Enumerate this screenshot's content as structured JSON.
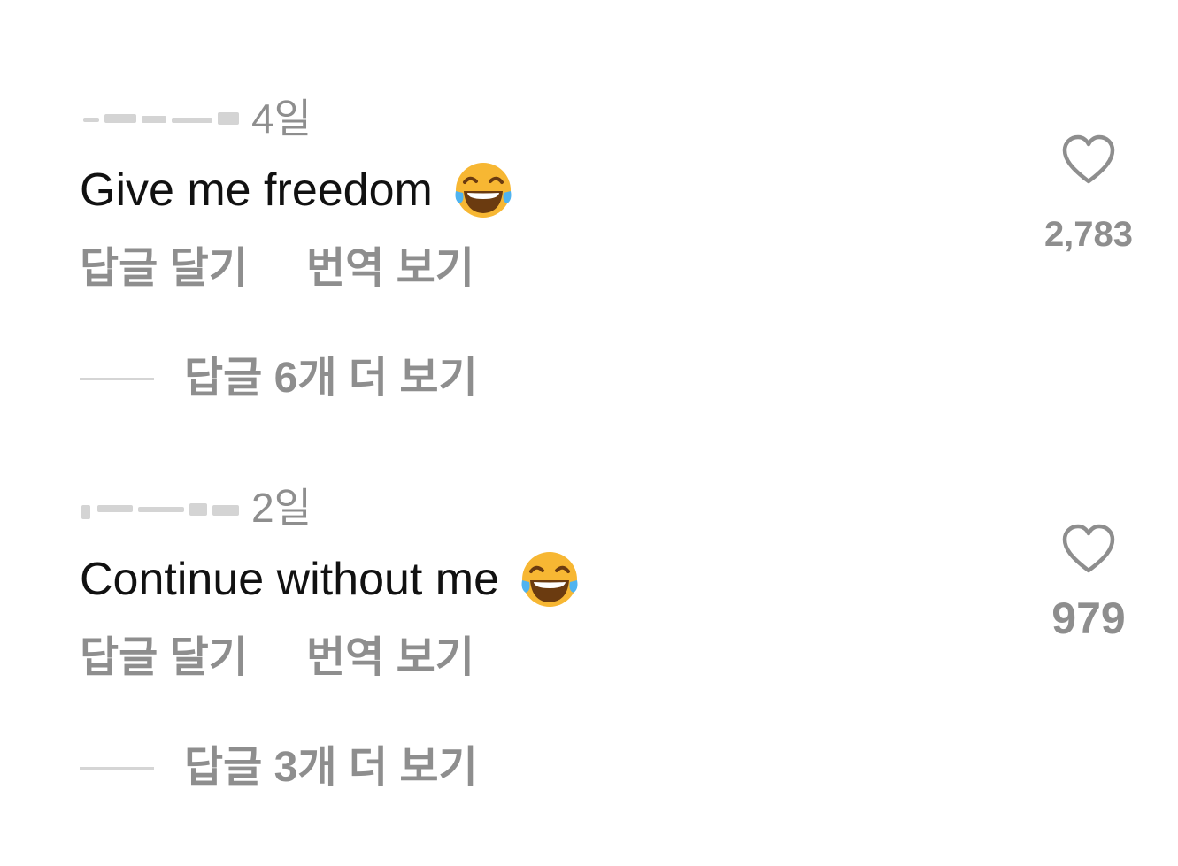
{
  "comments": [
    {
      "timestamp": "4일",
      "text": "Give me freedom",
      "emoji": "face-with-tears-of-joy",
      "actions": {
        "reply": "답글 달기",
        "translate": "번역 보기"
      },
      "replies_label": "답글 6개 더 보기",
      "like_count": "2,783"
    },
    {
      "timestamp": "2일",
      "text": "Continue without me",
      "emoji": "face-with-tears-of-joy",
      "actions": {
        "reply": "답글 달기",
        "translate": "번역 보기"
      },
      "replies_label": "답글 3개 더 보기",
      "like_count": "979"
    }
  ],
  "colors": {
    "text_primary": "#111111",
    "text_secondary": "#8e8e8e",
    "divider": "#d5d5d5",
    "emoji_face": "#f7b733",
    "emoji_tear": "#4fb3f0"
  }
}
